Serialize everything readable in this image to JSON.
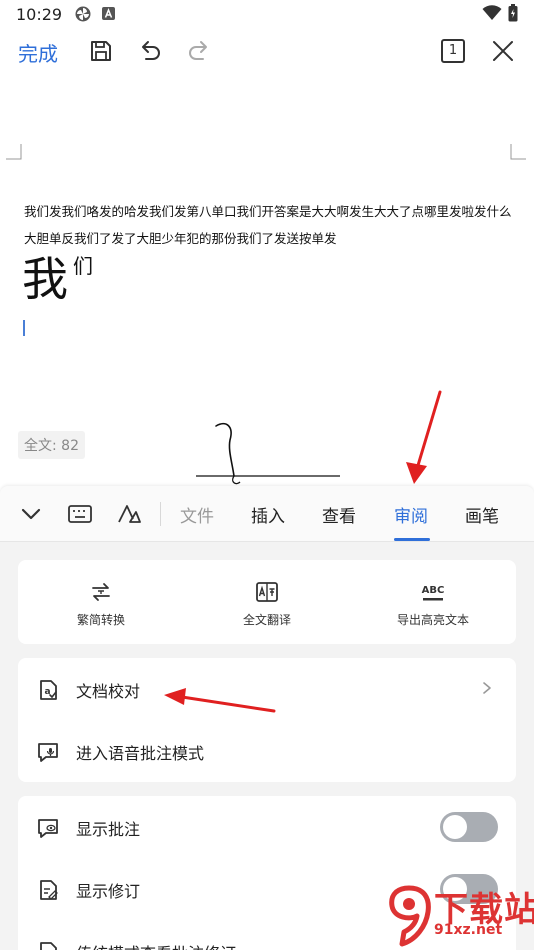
{
  "status_bar": {
    "time": "10:29"
  },
  "toolbar": {
    "done_label": "完成",
    "page_indicator": "1"
  },
  "document": {
    "line1": "我们发我们咯发的哈发我们发第八单口我们开答案是大大啊发生大大了点哪里发啦发什么",
    "line2": "大胆单反我们了发了大胆少年犯的那份我们了发送按单发",
    "big_char": "我",
    "sup_char": "们",
    "word_count": "全文: 82"
  },
  "tabs": [
    {
      "label": "文件",
      "state": "muted"
    },
    {
      "label": "插入",
      "state": "normal"
    },
    {
      "label": "查看",
      "state": "normal"
    },
    {
      "label": "审阅",
      "state": "active"
    },
    {
      "label": "画笔",
      "state": "normal"
    }
  ],
  "quick_actions": [
    {
      "label": "繁简转换",
      "icon": "convert-icon"
    },
    {
      "label": "全文翻译",
      "icon": "translate-icon"
    },
    {
      "label": "导出高亮文本",
      "icon": "abc-icon"
    }
  ],
  "menu_group1": [
    {
      "label": "文档校对",
      "icon": "proofread-icon"
    },
    {
      "label": "进入语音批注模式",
      "icon": "voice-comment-icon"
    }
  ],
  "menu_group2": [
    {
      "label": "显示批注",
      "icon": "show-comment-icon",
      "enabled": false
    },
    {
      "label": "显示修订",
      "icon": "show-revision-icon",
      "enabled": false
    },
    {
      "label": "传统模式查看批注修订",
      "icon": "classic-mode-icon"
    }
  ],
  "watermark": {
    "big": "下载站",
    "small": "91xz.net"
  },
  "colors": {
    "accent": "#2f6fd9",
    "annotation": "#e02020",
    "toggle_off": "#a9adb3"
  }
}
